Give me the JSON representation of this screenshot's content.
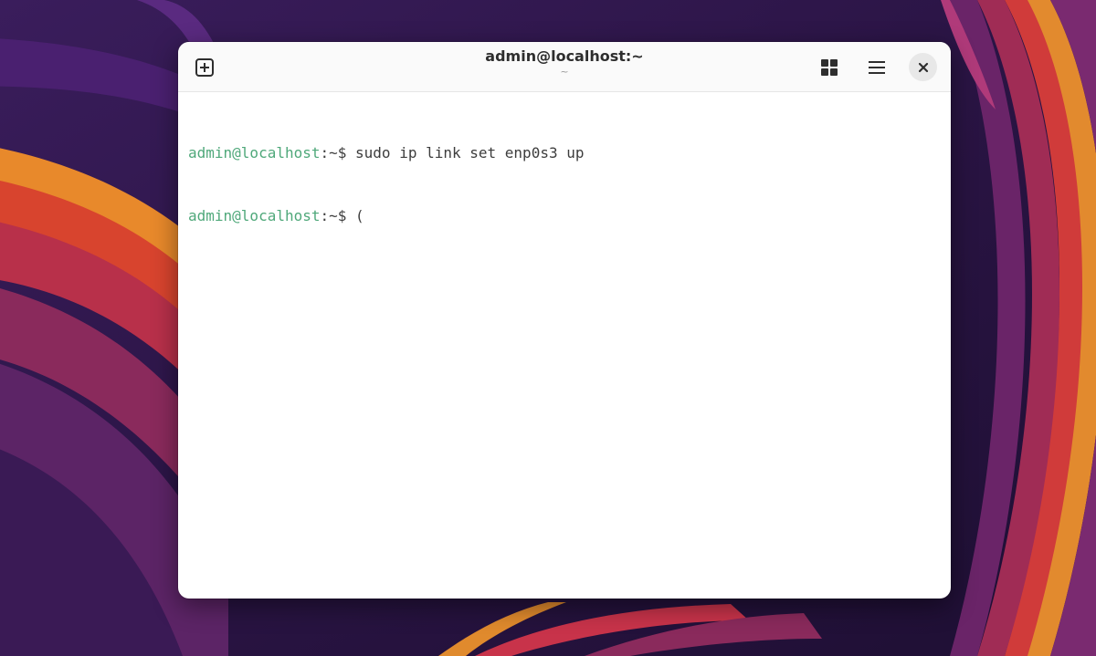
{
  "window": {
    "title": "admin@localhost:~",
    "subtitle": "~"
  },
  "headerbar": {
    "new_tab_icon": "new-tab-icon",
    "tabs_overview_icon": "grid-icon",
    "menu_icon": "hamburger-menu-icon",
    "close_icon": "close-icon"
  },
  "terminal": {
    "lines": [
      {
        "user_host": "admin@localhost",
        "path": ":~$ ",
        "command": "sudo ip link set enp0s3 up"
      },
      {
        "user_host": "admin@localhost",
        "path": ":~$ ",
        "command": "("
      }
    ]
  },
  "colors": {
    "prompt_user": "#4fa87a",
    "text": "#3d3d3d",
    "window_bg": "#ffffff",
    "headerbar_bg": "#fafafa"
  }
}
